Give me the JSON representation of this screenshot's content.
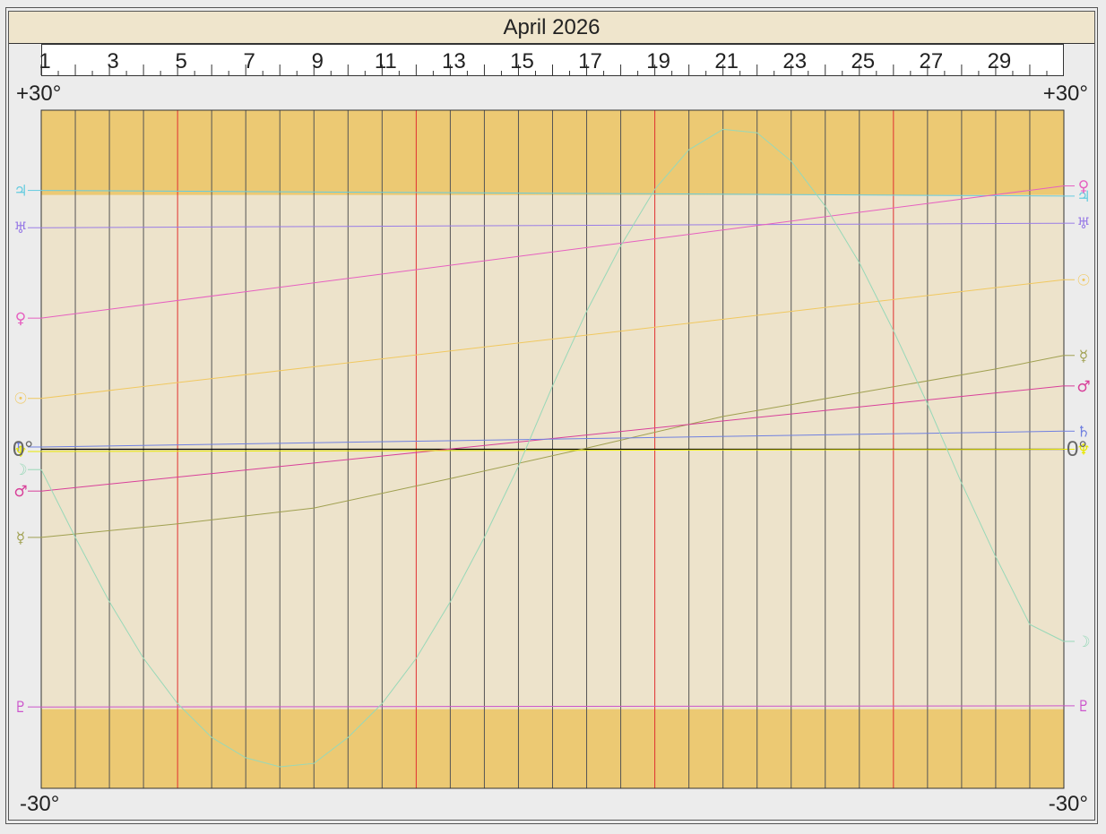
{
  "title": "April 2026",
  "axis": {
    "top_left": "+30°",
    "top_right": "+30°",
    "bottom_left": "-30°",
    "bottom_right": "-30°",
    "zero_left": "0°",
    "zero_right": "0°"
  },
  "colors": {
    "band": "#ecc973",
    "background": "#ede3cb",
    "grid": "#555555",
    "highlight_grid": "#e03030",
    "zero_line_black": "#000000",
    "zero_line_yellow": "#e8e800"
  },
  "chart_data": {
    "type": "line",
    "x_unit": "day",
    "xlim": [
      1,
      31
    ],
    "ylim": [
      -30,
      30
    ],
    "shaded_bands": [
      [
        22.5,
        30
      ],
      [
        -30,
        -23
      ]
    ],
    "x_tick_labels": [
      1,
      3,
      5,
      7,
      9,
      11,
      13,
      15,
      17,
      19,
      21,
      23,
      25,
      27,
      29
    ],
    "highlighted_days": [
      5,
      12,
      19,
      26
    ],
    "series": [
      {
        "symbol": "♃",
        "color": "#66cce0",
        "x": [
          1,
          31
        ],
        "y": [
          22.9,
          22.4
        ]
      },
      {
        "symbol": "♅",
        "color": "#9a7de6",
        "x": [
          1,
          31
        ],
        "y": [
          19.6,
          20.0
        ]
      },
      {
        "symbol": "♀",
        "color": "#e660c0",
        "x": [
          1,
          31
        ],
        "y": [
          11.6,
          23.3
        ]
      },
      {
        "symbol": "☉",
        "color": "#f0c860",
        "x": [
          1,
          31
        ],
        "y": [
          4.5,
          15.0
        ]
      },
      {
        "symbol": "☿",
        "color": "#a0a050",
        "x": [
          1,
          5,
          9,
          13,
          17,
          21,
          25,
          29,
          31
        ],
        "y": [
          -7.8,
          -6.6,
          -5.2,
          -2.6,
          0.1,
          2.9,
          5.0,
          7.1,
          8.3
        ]
      },
      {
        "symbol": "♂",
        "color": "#d8409a",
        "x": [
          1,
          31
        ],
        "y": [
          -3.7,
          5.6
        ]
      },
      {
        "symbol": "♄",
        "color": "#7080e0",
        "x": [
          1,
          31
        ],
        "y": [
          0.2,
          1.6
        ]
      },
      {
        "symbol": "♆",
        "color": "#e8e800",
        "x": [
          1,
          31
        ],
        "y": [
          -0.2,
          0.0
        ]
      },
      {
        "symbol": "♇",
        "color": "#cc55cc",
        "x": [
          1,
          31
        ],
        "y": [
          -22.8,
          -22.7
        ]
      },
      {
        "symbol": "☽",
        "color": "#98d8b8",
        "x": [
          1,
          2,
          3,
          4,
          5,
          6,
          7,
          8,
          9,
          10,
          11,
          12,
          13,
          14,
          15,
          16,
          17,
          18,
          19,
          20,
          21,
          22,
          23,
          24,
          25,
          26,
          27,
          28,
          29,
          30,
          31
        ],
        "y": [
          -1.8,
          -7.8,
          -13.5,
          -18.5,
          -22.5,
          -25.5,
          -27.3,
          -28.1,
          -27.8,
          -25.5,
          -22.5,
          -18.5,
          -13.5,
          -7.8,
          -1.5,
          5.6,
          12.2,
          18.0,
          23.0,
          26.5,
          28.3,
          28.0,
          25.5,
          21.5,
          16.5,
          10.5,
          4.0,
          -3.0,
          -9.5,
          -15.5,
          -17.0
        ]
      }
    ]
  }
}
